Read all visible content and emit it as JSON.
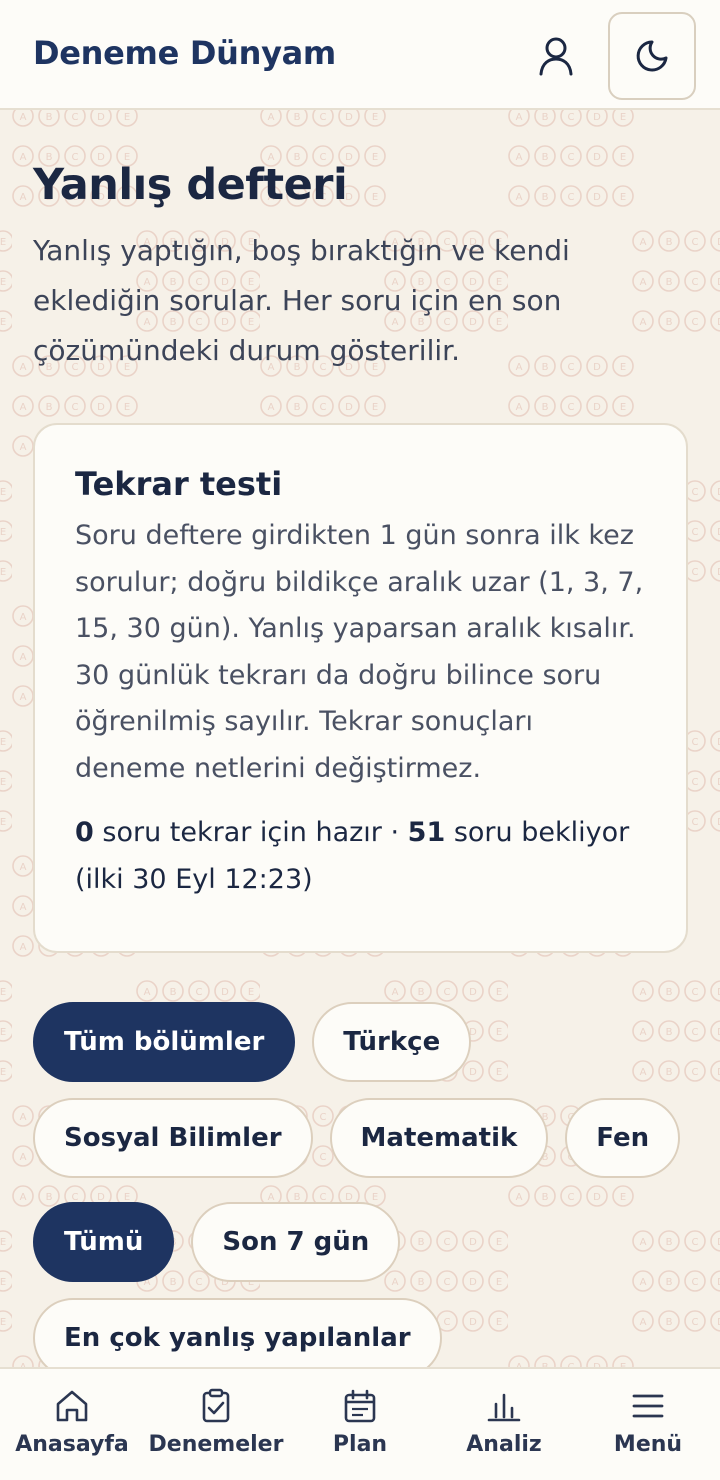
{
  "header": {
    "brand": "Deneme Dünyam",
    "user_icon": "user-icon",
    "theme_icon": "moon-icon"
  },
  "page": {
    "title": "Yanlış defteri",
    "description": "Yanlış yaptığın, boş bıraktığın ve kendi eklediğin sorular. Her soru için en son çözümündeki durum gösterilir."
  },
  "review_card": {
    "title": "Tekrar testi",
    "text": "Soru deftere girdikten 1 gün sonra ilk kez sorulur; doğru bildikçe aralık uzar (1, 3, 7, 15, 30 gün). Yanlış yaparsan aralık kısalır. 30 günlük tekrarı da doğru bilince soru öğrenilmiş sayılır. Tekrar sonuçları deneme netlerini değiştirmez.",
    "ready_count": "0",
    "ready_label": " soru tekrar için hazır · ",
    "waiting_count": "51",
    "waiting_label": " soru bekliyor (ilki 30 Eyl 12:23)"
  },
  "section_filters": {
    "selected": "Tüm bölümler",
    "items": [
      "Tüm bölümler",
      "Türkçe",
      "Sosyal Bilimler",
      "Matematik",
      "Fen"
    ]
  },
  "time_filters": {
    "selected": "Tümü",
    "items": [
      "Tümü",
      "Son 7 gün",
      "En çok yanlış yapılanlar"
    ]
  },
  "bottom_nav": {
    "items": [
      {
        "label": "Anasayfa",
        "icon": "home-icon"
      },
      {
        "label": "Denemeler",
        "icon": "clipboard-check-icon"
      },
      {
        "label": "Plan",
        "icon": "calendar-icon"
      },
      {
        "label": "Analiz",
        "icon": "bar-chart-icon"
      },
      {
        "label": "Menü",
        "icon": "menu-icon"
      }
    ]
  },
  "colors": {
    "brand": "#1e3461",
    "background": "#f6f1e8",
    "surface": "#fdfcf8",
    "border": "#e4dccd",
    "pattern": "#ead3c8"
  }
}
